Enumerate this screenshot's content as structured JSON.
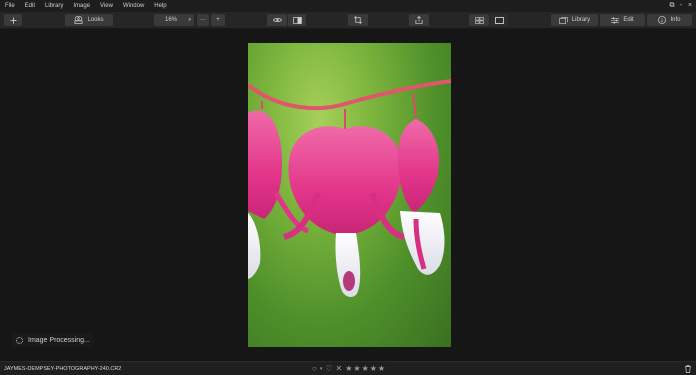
{
  "menu": [
    "File",
    "Edit",
    "Library",
    "Image",
    "View",
    "Window",
    "Help"
  ],
  "window_controls": {
    "restore": "⧉",
    "minimize": "-",
    "close": "×"
  },
  "toolbar": {
    "add_icon": "plus-icon",
    "looks_label": "Looks",
    "zoom_value": "16%",
    "zoom_more": "···",
    "zoom_in": "+",
    "library_label": "Library",
    "edit_label": "Edit",
    "info_label": "Info"
  },
  "canvas": {
    "processing_label": "Image Processing..."
  },
  "status": {
    "filename": "JAYMES-DEMPSEY-PHOTOGRAPHY-240.CR2",
    "rating_stars": 0,
    "max_stars": 5
  },
  "colors": {
    "accent": "#e0e0e0",
    "flower_pink": "#e63c8f",
    "stem_red": "#e0566a",
    "background_green": "#6fa83a"
  }
}
